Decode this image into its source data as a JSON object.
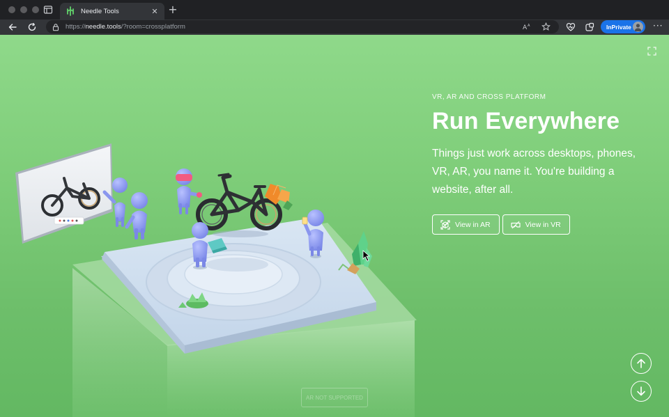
{
  "browser": {
    "tab": {
      "title": "Needle Tools"
    },
    "address": {
      "scheme": "https://",
      "host": "needle.tools",
      "path": "/?room=crossplatform"
    },
    "inprivate_label": "InPrivate"
  },
  "hero": {
    "eyebrow": "VR, AR AND CROSS PLATFORM",
    "headline": "Run Everywhere",
    "lead": "Things just work across desktops, phones, VR, AR, you name it. You're building a website, after all.",
    "buttons": {
      "ar": "View in AR",
      "vr": "View in VR"
    }
  },
  "ar_status": "AR NOT SUPPORTED",
  "colors": {
    "page_top": "#8fd98a",
    "page_bottom": "#63b862",
    "accent_blue": "#1a73e8",
    "figure": "#8f9af0"
  }
}
